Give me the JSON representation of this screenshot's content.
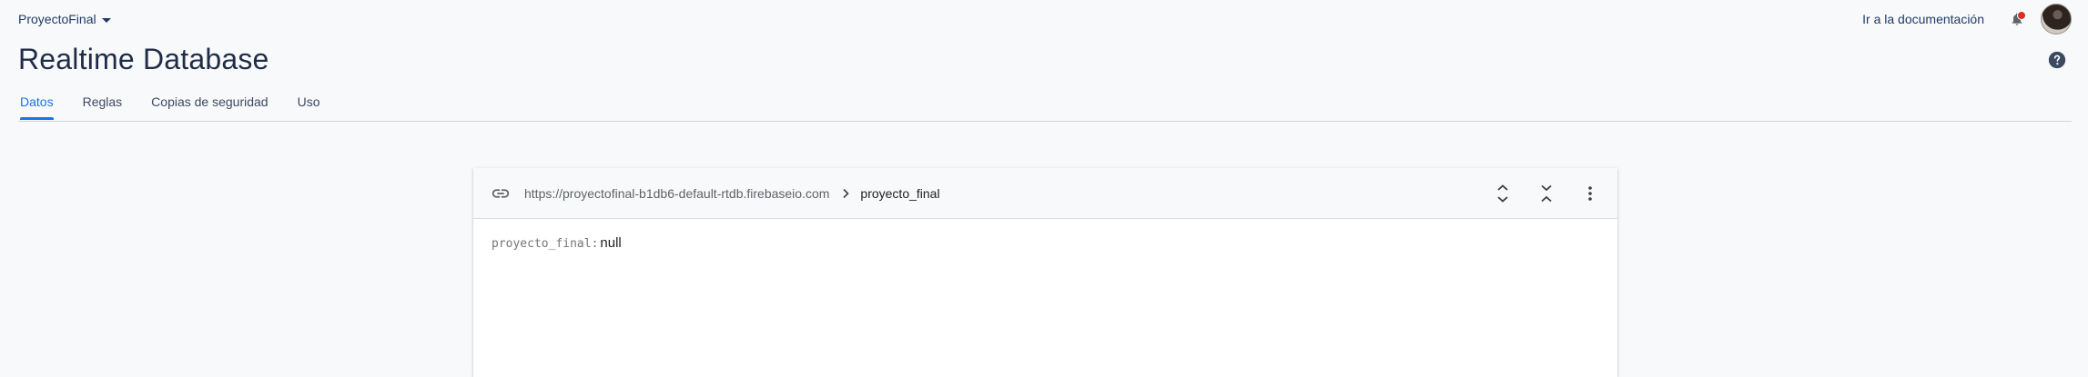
{
  "header": {
    "project_name": "ProyectoFinal",
    "docs_link": "Ir a la documentación"
  },
  "page": {
    "title": "Realtime Database"
  },
  "tabs": [
    {
      "label": "Datos",
      "active": true
    },
    {
      "label": "Reglas",
      "active": false
    },
    {
      "label": "Copias de seguridad",
      "active": false
    },
    {
      "label": "Uso",
      "active": false
    }
  ],
  "database": {
    "url": "https://proyectofinal-b1db6-default-rtdb.firebaseio.com",
    "current_node": "proyecto_final",
    "data": {
      "key": "proyecto_final",
      "colon": ":",
      "value": "null"
    }
  },
  "icons": {
    "project_dropdown": "caret-down-icon",
    "notifications": "bell-icon",
    "help": "help-circle-icon",
    "link": "link-icon",
    "breadcrumb_separator": "chevron-right-icon",
    "expand_all": "expand-all-icon",
    "collapse_all": "collapse-all-icon",
    "more": "more-vert-icon"
  },
  "colors": {
    "accent": "#1a73e8",
    "title": "#1f2d47",
    "notification_dot": "#d93025",
    "background": "#f8f9fa"
  }
}
